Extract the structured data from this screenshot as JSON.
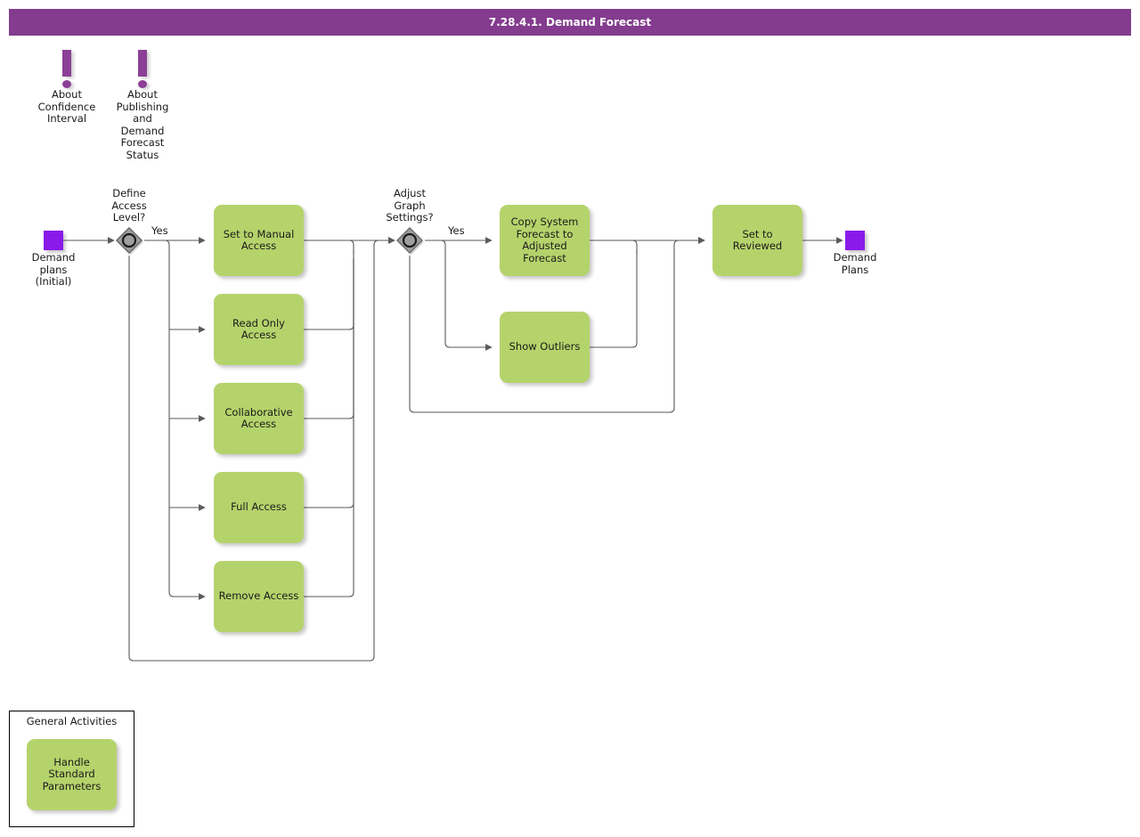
{
  "titlebar": {
    "title": "7.28.4.1. Demand Forecast",
    "bg_color": "#833c8e",
    "text_color": "#ffffff"
  },
  "palette": {
    "task_fill": "#b5d36b",
    "event_fill": "#8a1ae8",
    "gateway_fill": "#9e9e9e",
    "note_fill": "#8b3f96",
    "connector": "#4d4d4d"
  },
  "notes": [
    {
      "id": "note-confidence-interval",
      "icon": "exclamation-note-icon",
      "label": "About\nConfidence\nInterval"
    },
    {
      "id": "note-publishing-status",
      "icon": "exclamation-note-icon",
      "label": "About\nPublishing\nand\nDemand\nForecast\nStatus"
    }
  ],
  "events": [
    {
      "id": "start-demand-plans-initial",
      "type": "start",
      "label": "Demand\nplans\n(Initial)"
    },
    {
      "id": "end-demand-plans",
      "type": "end",
      "label": "Demand\nPlans"
    }
  ],
  "gateways": [
    {
      "id": "gateway-define-access-level",
      "type": "inclusive",
      "label": "Define\nAccess\nLevel?",
      "flow_label": "Yes"
    },
    {
      "id": "gateway-adjust-graph-settings",
      "type": "inclusive",
      "label": "Adjust\nGraph\nSettings?",
      "flow_label": "Yes"
    }
  ],
  "tasks": [
    {
      "id": "task-set-to-manual-access",
      "label": "Set to Manual\nAccess"
    },
    {
      "id": "task-read-only-access",
      "label": "Read Only\nAccess"
    },
    {
      "id": "task-collaborative-access",
      "label": "Collaborative\nAccess"
    },
    {
      "id": "task-full-access",
      "label": "Full Access"
    },
    {
      "id": "task-remove-access",
      "label": "Remove Access"
    },
    {
      "id": "task-copy-system-forecast",
      "label": "Copy System\nForecast to\nAdjusted\nForecast"
    },
    {
      "id": "task-show-outliers",
      "label": "Show Outliers"
    },
    {
      "id": "task-set-to-reviewed",
      "label": "Set to Reviewed"
    }
  ],
  "group": {
    "title": "General Activities",
    "task": {
      "id": "task-handle-standard-parameters",
      "label": "Handle Standard\nParameters"
    }
  }
}
